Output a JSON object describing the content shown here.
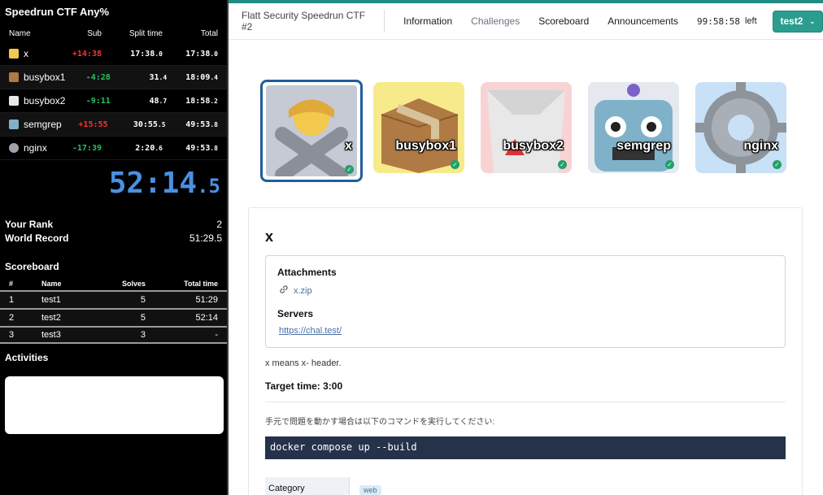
{
  "splits": {
    "title": "Speedrun CTF Any%",
    "headers": {
      "name": "Name",
      "sub": "Sub",
      "split": "Split time",
      "total": "Total"
    },
    "rows": [
      {
        "icon": "no-gesture-person-icon",
        "name": "x",
        "sub": "+14:38",
        "sub_color": "#ff3030",
        "split": "17:38",
        "split_ms": ".0",
        "total": "17:38",
        "total_ms": ".0"
      },
      {
        "icon": "package-box-icon",
        "name": "busybox1",
        "sub": "-4:28",
        "sub_color": "#22c55e",
        "split": "31",
        "split_ms": ".4",
        "total": "18:09",
        "total_ms": ".4"
      },
      {
        "icon": "takeout-box-icon",
        "name": "busybox2",
        "sub": "-9:11",
        "sub_color": "#22c55e",
        "split": "48",
        "split_ms": ".7",
        "total": "18:58",
        "total_ms": ".2"
      },
      {
        "icon": "robot-icon",
        "name": "semgrep",
        "sub": "+15:55",
        "sub_color": "#ff3030",
        "split": "30:55",
        "split_ms": ".5",
        "total": "49:53",
        "total_ms": ".8"
      },
      {
        "icon": "gear-icon",
        "name": "nginx",
        "sub": "-17:39",
        "sub_color": "#22c55e",
        "split": "2:20",
        "split_ms": ".6",
        "total": "49:53",
        "total_ms": ".8"
      }
    ],
    "timer": "52:14",
    "timer_ms": ".5",
    "rank_label": "Your Rank",
    "rank_value": "2",
    "record_label": "World Record",
    "record_value": "51:29.5"
  },
  "scoreboard": {
    "title": "Scoreboard",
    "headers": {
      "rank": "#",
      "name": "Name",
      "solves": "Solves",
      "time": "Total time"
    },
    "rows": [
      {
        "rank": "1",
        "name": "test1",
        "solves": "5",
        "time": "51:29"
      },
      {
        "rank": "2",
        "name": "test2",
        "solves": "5",
        "time": "52:14"
      },
      {
        "rank": "3",
        "name": "test3",
        "solves": "3",
        "time": "-"
      }
    ]
  },
  "activities": {
    "title": "Activities"
  },
  "nav": {
    "brand": "Flatt Security Speedrun CTF #2",
    "links": [
      "Information",
      "Challenges",
      "Scoreboard",
      "Announcements"
    ],
    "timer": "99:58:58",
    "timer_suffix": "left",
    "user": "test2",
    "user_icon": "chevron-down-icon"
  },
  "challenges": [
    {
      "name": "x",
      "icon": "no-gesture-person-icon",
      "bg": "#c5cad4",
      "solved": true,
      "selected": true
    },
    {
      "name": "busybox1",
      "icon": "package-box-icon",
      "bg": "#f7ea8a",
      "solved": true
    },
    {
      "name": "busybox2",
      "icon": "takeout-box-icon",
      "bg": "#f9d3d3",
      "solved": true
    },
    {
      "name": "semgrep",
      "icon": "robot-icon",
      "bg": "#e5e9ef",
      "solved": true
    },
    {
      "name": "nginx",
      "icon": "gear-icon",
      "bg": "#c9e1f7",
      "solved": true
    }
  ],
  "detail": {
    "title": "x",
    "attachments_label": "Attachments",
    "attachment_file": "x.zip",
    "servers_label": "Servers",
    "server_url": "https://chal.test/",
    "description": "x means x- header.",
    "target_time": "Target time: 3:00",
    "jp_note": "手元で問題を動かす場合は以下のコマンドを実行してください:",
    "command": "docker compose up --build",
    "category_label": "Category",
    "category_tag": "web"
  }
}
